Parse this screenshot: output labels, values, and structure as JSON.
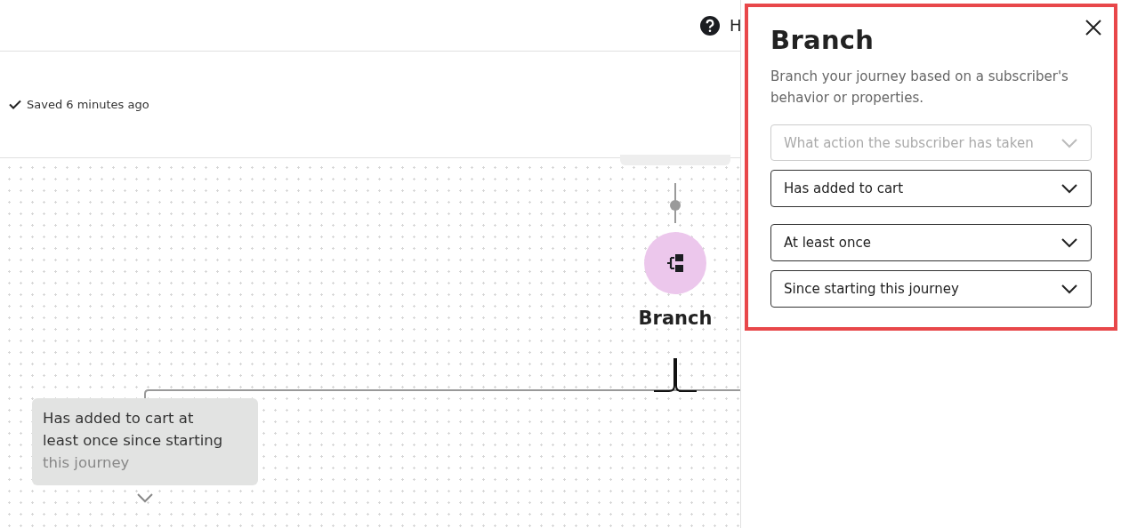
{
  "header": {
    "help_label": "H"
  },
  "toolbar": {
    "save_status": "Saved 6 minutes ago"
  },
  "canvas": {
    "node": {
      "label": "Branch"
    },
    "branch_card": {
      "lines": [
        "Has added to cart at",
        "least once since starting",
        "this journey"
      ]
    }
  },
  "panel": {
    "title": "Branch",
    "description": "Branch your journey based on a subscriber's behavior or properties.",
    "field_groups": [
      [
        {
          "placeholder": "What action the subscriber has taken",
          "disabled": true
        },
        {
          "value": "Has added to cart",
          "disabled": false
        }
      ],
      [
        {
          "value": "At least once",
          "disabled": false
        },
        {
          "value": "Since starting this journey",
          "disabled": false
        }
      ]
    ]
  }
}
